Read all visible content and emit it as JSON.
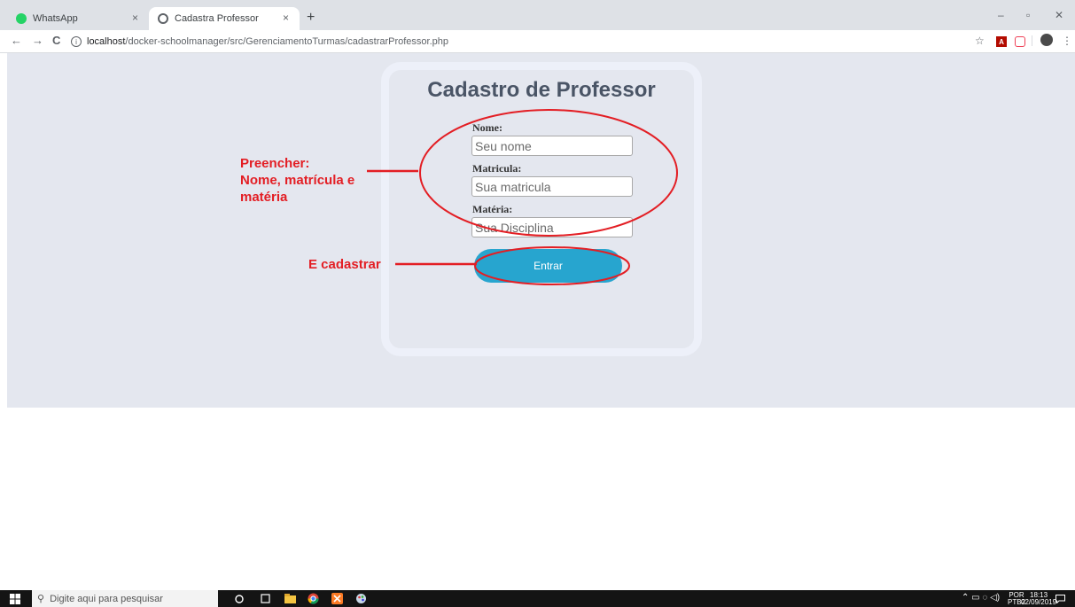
{
  "browser": {
    "tabs": [
      {
        "title": "WhatsApp",
        "close": "×"
      },
      {
        "title": "Cadastra Professor",
        "close": "×"
      }
    ],
    "new_tab": "+",
    "window_controls": {
      "minimize": "–",
      "restore": "▫",
      "close": "✕"
    },
    "nav": {
      "back": "←",
      "forward": "→",
      "reload": "C"
    },
    "url": {
      "info": "i",
      "host": "localhost",
      "path": "/docker-schoolmanager/src/GerenciamentoTurmas/cadastrarProfessor.php"
    },
    "toolbar_icons": {
      "star": "☆",
      "pdf": "A",
      "menu": "⋮"
    }
  },
  "form": {
    "title": "Cadastro de Professor",
    "fields": [
      {
        "label": "Nome:",
        "placeholder": "Seu nome"
      },
      {
        "label": "Matricula:",
        "placeholder": "Sua matricula"
      },
      {
        "label": "Matéria:",
        "placeholder": "Sua Disciplina"
      }
    ],
    "submit_label": "Entrar"
  },
  "annotations": {
    "fill_note": [
      "Preencher:",
      "Nome, matrícula e",
      "matéria"
    ],
    "submit_note": "E cadastrar",
    "color": "#e31e24"
  },
  "taskbar": {
    "search_placeholder": "Digite aqui para pesquisar",
    "language": "POR",
    "layout": "PTB2",
    "time": "18:13",
    "date": "02/09/2019"
  }
}
